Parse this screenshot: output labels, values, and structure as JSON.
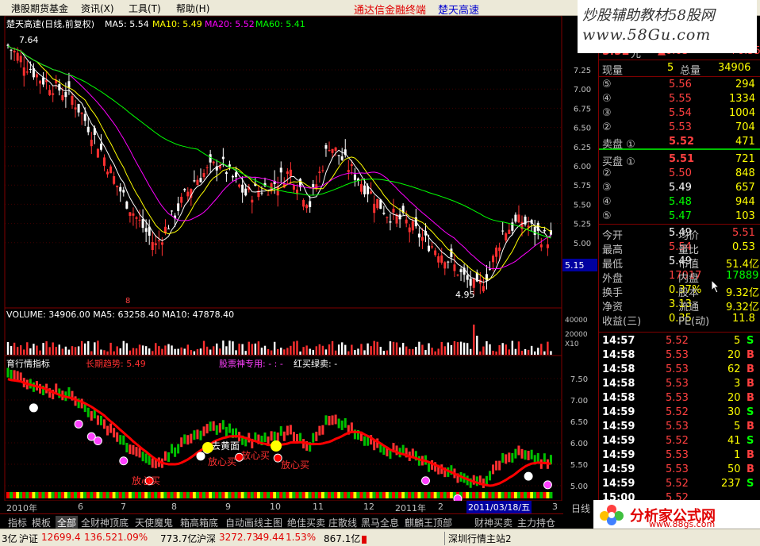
{
  "menu": {
    "items": [
      "港股期货基金",
      "资讯(X)",
      "工具(T)",
      "帮助(H)"
    ],
    "title_red": "通达信金融终端",
    "title_blue": "楚天高速"
  },
  "watermarks": {
    "top_line1": "炒股辅助教材58股网",
    "top_line2": "www.58Gu.com",
    "bottom_text": "分析家公式网",
    "bottom_url": "www.88gs.com"
  },
  "main_chart": {
    "header": {
      "name": "楚天高速(日线,前复权)",
      "ma5_label": "MA5: 5.54",
      "ma10_label": "MA10: 5.49",
      "ma20_label": "MA20: 5.52",
      "ma60_label": "MA60: 5.41"
    },
    "high_label": "7.64",
    "low_label": "4.95",
    "current_price_tag": "5.15",
    "marker": "8",
    "y_ticks": [
      "7.25",
      "7.00",
      "6.75",
      "6.50",
      "6.25",
      "6.00",
      "5.75",
      "5.50",
      "5.25",
      "5.00"
    ],
    "colors": {
      "ma5": "#ffffff",
      "ma10": "#ffff00",
      "ma20": "#ff00ff",
      "ma60": "#00ff00",
      "axis": "#800000",
      "grid": "#400000"
    }
  },
  "volume_chart": {
    "header": "VOLUME: 34906.00  MA5: 63258.40  MA10: 47878.40",
    "y_ticks": [
      "40000",
      "20000",
      "X10"
    ]
  },
  "indicator_chart": {
    "header_name": "育行情指标",
    "label_red": "长期趋势: 5.49",
    "label_pink": "股票神专用: - : -",
    "label_white": "红买绿卖: -",
    "y_ticks": [
      "7.50",
      "7.00",
      "6.50",
      "6.00",
      "5.50",
      "5.00"
    ],
    "annotations": [
      "放心买",
      "放心买",
      "放心买",
      "放心买",
      "去黄面"
    ],
    "date_current": "2011/03/18/五"
  },
  "date_axis": {
    "labels": [
      "2010年",
      "6",
      "7",
      "8",
      "9",
      "10",
      "11",
      "12",
      "2011年",
      "2",
      "3"
    ],
    "period": "日线"
  },
  "quote_panel": {
    "price": "5.52",
    "unit": "元",
    "change": "▲0.03",
    "change_pct": "+0.55",
    "now_vol_label": "现量",
    "now_vol": "5",
    "total_vol_label": "总量",
    "total_vol": "34906",
    "sell": [
      {
        "label": "⑤",
        "price": "5.56",
        "vol": "294"
      },
      {
        "label": "④",
        "price": "5.55",
        "vol": "1334"
      },
      {
        "label": "③",
        "price": "5.54",
        "vol": "1004"
      },
      {
        "label": "②",
        "price": "5.53",
        "vol": "704"
      },
      {
        "label": "卖盘 ①",
        "price": "5.52",
        "vol": "471"
      }
    ],
    "buy": [
      {
        "label": "买盘 ①",
        "price": "5.51",
        "vol": "721"
      },
      {
        "label": "②",
        "price": "5.50",
        "vol": "848"
      },
      {
        "label": "③",
        "price": "5.49",
        "vol": "657"
      },
      {
        "label": "④",
        "price": "5.48",
        "vol": "944"
      },
      {
        "label": "⑤",
        "price": "5.47",
        "vol": "103"
      }
    ],
    "stats": [
      {
        "l1": "今开",
        "v1": "5.49",
        "c1": "#ffffff",
        "l2": "均价",
        "v2": "5.51",
        "c2": "#ff4040"
      },
      {
        "l1": "最高",
        "v1": "5.54",
        "c1": "#ff4040",
        "l2": "量比",
        "v2": "0.53",
        "c2": "#ffff00"
      },
      {
        "l1": "最低",
        "v1": "5.49",
        "c1": "#ffffff",
        "l2": "市值",
        "v2": "51.4亿",
        "c2": "#ffff00"
      },
      {
        "l1": "外盘",
        "v1": "17017",
        "c1": "#ff4040",
        "l2": "内盘",
        "v2": "17889",
        "c2": "#00ff00"
      },
      {
        "l1": "换手",
        "v1": "0.37%",
        "c1": "#ffff00",
        "l2": "股本",
        "v2": "9.32亿",
        "c2": "#ffff00"
      },
      {
        "l1": "净资",
        "v1": "3.13",
        "c1": "#ffff00",
        "l2": "流通",
        "v2": "9.32亿",
        "c2": "#ffff00"
      },
      {
        "l1": "收益(三)",
        "v1": "0.35",
        "c1": "#ffff00",
        "l2": "PE(动)",
        "v2": "11.8",
        "c2": "#ffff00"
      }
    ],
    "ticks": [
      {
        "t": "14:57",
        "p": "5.52",
        "v": "5",
        "d": "S"
      },
      {
        "t": "14:58",
        "p": "5.53",
        "v": "20",
        "d": "B"
      },
      {
        "t": "14:58",
        "p": "5.53",
        "v": "62",
        "d": "B"
      },
      {
        "t": "14:58",
        "p": "5.53",
        "v": "3",
        "d": "B"
      },
      {
        "t": "14:58",
        "p": "5.53",
        "v": "20",
        "d": "B"
      },
      {
        "t": "14:59",
        "p": "5.52",
        "v": "30",
        "d": "S"
      },
      {
        "t": "14:59",
        "p": "5.53",
        "v": "5",
        "d": "B"
      },
      {
        "t": "14:59",
        "p": "5.52",
        "v": "41",
        "d": "S"
      },
      {
        "t": "14:59",
        "p": "5.53",
        "v": "1",
        "d": "B"
      },
      {
        "t": "14:59",
        "p": "5.53",
        "v": "50",
        "d": "B"
      },
      {
        "t": "14:59",
        "p": "5.52",
        "v": "237",
        "d": "S"
      },
      {
        "t": "15:00",
        "p": "5.52",
        "v": "",
        "d": ""
      }
    ]
  },
  "tabs": [
    "指标",
    "模板",
    "全部",
    "全财神顶底",
    "天使魔鬼",
    "箱高箱底",
    "自动画线主图",
    "绝佳买卖",
    "庄散线",
    "黑马全息",
    "麒麟王顶部",
    "财神买卖",
    "主力持仓"
  ],
  "status": {
    "s1": "3亿",
    "s2": "沪证",
    "s3": "12699.4",
    "s4": "136.52",
    "s5": "1.09%",
    "s6": "773.7亿",
    "s7": "沪深",
    "s8": "3272.73",
    "s9": "49.44",
    "s10": "1.53%",
    "s11": "867.1亿",
    "s12": "深圳行情主站2"
  }
}
